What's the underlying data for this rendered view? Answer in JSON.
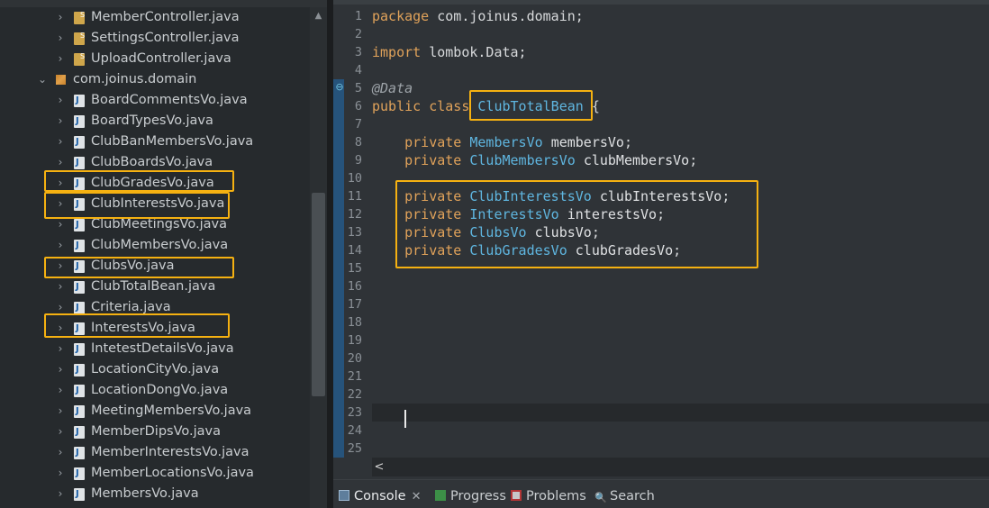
{
  "explorer": {
    "rows": [
      {
        "label": "MemberController.java",
        "kind": "controller",
        "depth": 2,
        "expandable": true
      },
      {
        "label": "SettingsController.java",
        "kind": "controller",
        "depth": 2,
        "expandable": true
      },
      {
        "label": "UploadController.java",
        "kind": "controller",
        "depth": 2,
        "expandable": true
      },
      {
        "label": "com.joinus.domain",
        "kind": "package",
        "depth": 1,
        "expanded": true
      },
      {
        "label": "BoardCommentsVo.java",
        "kind": "java",
        "depth": 2,
        "expandable": true
      },
      {
        "label": "BoardTypesVo.java",
        "kind": "java",
        "depth": 2,
        "expandable": true
      },
      {
        "label": "ClubBanMembersVo.java",
        "kind": "java",
        "depth": 2,
        "expandable": true
      },
      {
        "label": "ClubBoardsVo.java",
        "kind": "java",
        "depth": 2,
        "expandable": true
      },
      {
        "label": "ClubGradesVo.java",
        "kind": "java",
        "depth": 2,
        "expandable": true,
        "highlighted": true
      },
      {
        "label": "ClubInterestsVo.java",
        "kind": "java",
        "depth": 2,
        "expandable": true,
        "highlighted": true
      },
      {
        "label": "ClubMeetingsVo.java",
        "kind": "java",
        "depth": 2,
        "expandable": true
      },
      {
        "label": "ClubMembersVo.java",
        "kind": "java",
        "depth": 2,
        "expandable": true
      },
      {
        "label": "ClubsVo.java",
        "kind": "java",
        "depth": 2,
        "expandable": true,
        "highlighted": true
      },
      {
        "label": "ClubTotalBean.java",
        "kind": "java",
        "depth": 2,
        "expandable": true
      },
      {
        "label": "Criteria.java",
        "kind": "java",
        "depth": 2,
        "expandable": true
      },
      {
        "label": "InterestsVo.java",
        "kind": "java",
        "depth": 2,
        "expandable": true,
        "highlighted": true
      },
      {
        "label": "IntetestDetailsVo.java",
        "kind": "java",
        "depth": 2,
        "expandable": true
      },
      {
        "label": "LocationCityVo.java",
        "kind": "java",
        "depth": 2,
        "expandable": true
      },
      {
        "label": "LocationDongVo.java",
        "kind": "java",
        "depth": 2,
        "expandable": true
      },
      {
        "label": "MeetingMembersVo.java",
        "kind": "java",
        "depth": 2,
        "expandable": true
      },
      {
        "label": "MemberDipsVo.java",
        "kind": "java",
        "depth": 2,
        "expandable": true
      },
      {
        "label": "MemberInterestsVo.java",
        "kind": "java",
        "depth": 2,
        "expandable": true
      },
      {
        "label": "MemberLocationsVo.java",
        "kind": "java",
        "depth": 2,
        "expandable": true
      },
      {
        "label": "MembersVo.java",
        "kind": "java",
        "depth": 2,
        "expandable": true
      }
    ]
  },
  "editor": {
    "line_numbers": [
      "1",
      "2",
      "3",
      "4",
      "5",
      "6",
      "7",
      "8",
      "9",
      "10",
      "11",
      "12",
      "13",
      "14",
      "15",
      "16",
      "17",
      "18",
      "19",
      "20",
      "21",
      "22",
      "23",
      "24",
      "25"
    ],
    "lines": [
      [
        {
          "t": "package",
          "c": "kw"
        },
        {
          "t": " com.joinus.domain;"
        }
      ],
      [],
      [
        {
          "t": "import",
          "c": "kw"
        },
        {
          "t": " lombok.Data;"
        }
      ],
      [],
      [
        {
          "t": "@Data",
          "c": "ann"
        }
      ],
      [
        {
          "t": "public class ",
          "c": "kw"
        },
        {
          "t": "ClubTotalBean",
          "c": "type",
          "box": true
        },
        {
          "t": " {"
        }
      ],
      [],
      [
        {
          "t": "    "
        },
        {
          "t": "private",
          "c": "kw"
        },
        {
          "t": " "
        },
        {
          "t": "MembersVo",
          "c": "type"
        },
        {
          "t": " "
        },
        {
          "t": "membersVo",
          "c": "ident"
        },
        {
          "t": ";"
        }
      ],
      [
        {
          "t": "    "
        },
        {
          "t": "private",
          "c": "kw"
        },
        {
          "t": " "
        },
        {
          "t": "ClubMembersVo",
          "c": "type"
        },
        {
          "t": " "
        },
        {
          "t": "clubMembersVo",
          "c": "ident"
        },
        {
          "t": ";"
        }
      ],
      [],
      [
        {
          "t": "    "
        },
        {
          "t": "private",
          "c": "kw"
        },
        {
          "t": " "
        },
        {
          "t": "ClubInterestsVo",
          "c": "type"
        },
        {
          "t": " "
        },
        {
          "t": "clubInterestsVo",
          "c": "ident"
        },
        {
          "t": ";"
        }
      ],
      [
        {
          "t": "    "
        },
        {
          "t": "private",
          "c": "kw"
        },
        {
          "t": " "
        },
        {
          "t": "InterestsVo",
          "c": "type"
        },
        {
          "t": " "
        },
        {
          "t": "interestsVo",
          "c": "ident"
        },
        {
          "t": ";"
        }
      ],
      [
        {
          "t": "    "
        },
        {
          "t": "private",
          "c": "kw"
        },
        {
          "t": " "
        },
        {
          "t": "ClubsVo",
          "c": "type"
        },
        {
          "t": " "
        },
        {
          "t": "clubsVo",
          "c": "ident"
        },
        {
          "t": ";"
        }
      ],
      [
        {
          "t": "    "
        },
        {
          "t": "private",
          "c": "kw"
        },
        {
          "t": " "
        },
        {
          "t": "ClubGradesVo",
          "c": "type"
        },
        {
          "t": " "
        },
        {
          "t": "clubGradesVo",
          "c": "ident"
        },
        {
          "t": ";"
        }
      ],
      [],
      [],
      [],
      [],
      [],
      [],
      [],
      [],
      [],
      [],
      []
    ],
    "current_line": "23",
    "scroll_left_icon": "chevron-left-icon"
  },
  "bottom_tabs": [
    {
      "label": "Console",
      "icon": "console-icon",
      "active": true,
      "closable": true
    },
    {
      "label": "Progress",
      "icon": "progress-icon"
    },
    {
      "label": "Problems",
      "icon": "problems-icon"
    },
    {
      "label": "Search",
      "icon": "search-icon"
    }
  ],
  "colors": {
    "highlight": "#f5b111",
    "keyword": "#e0a25a",
    "type": "#5fb6e0",
    "background": "#2f3337"
  }
}
